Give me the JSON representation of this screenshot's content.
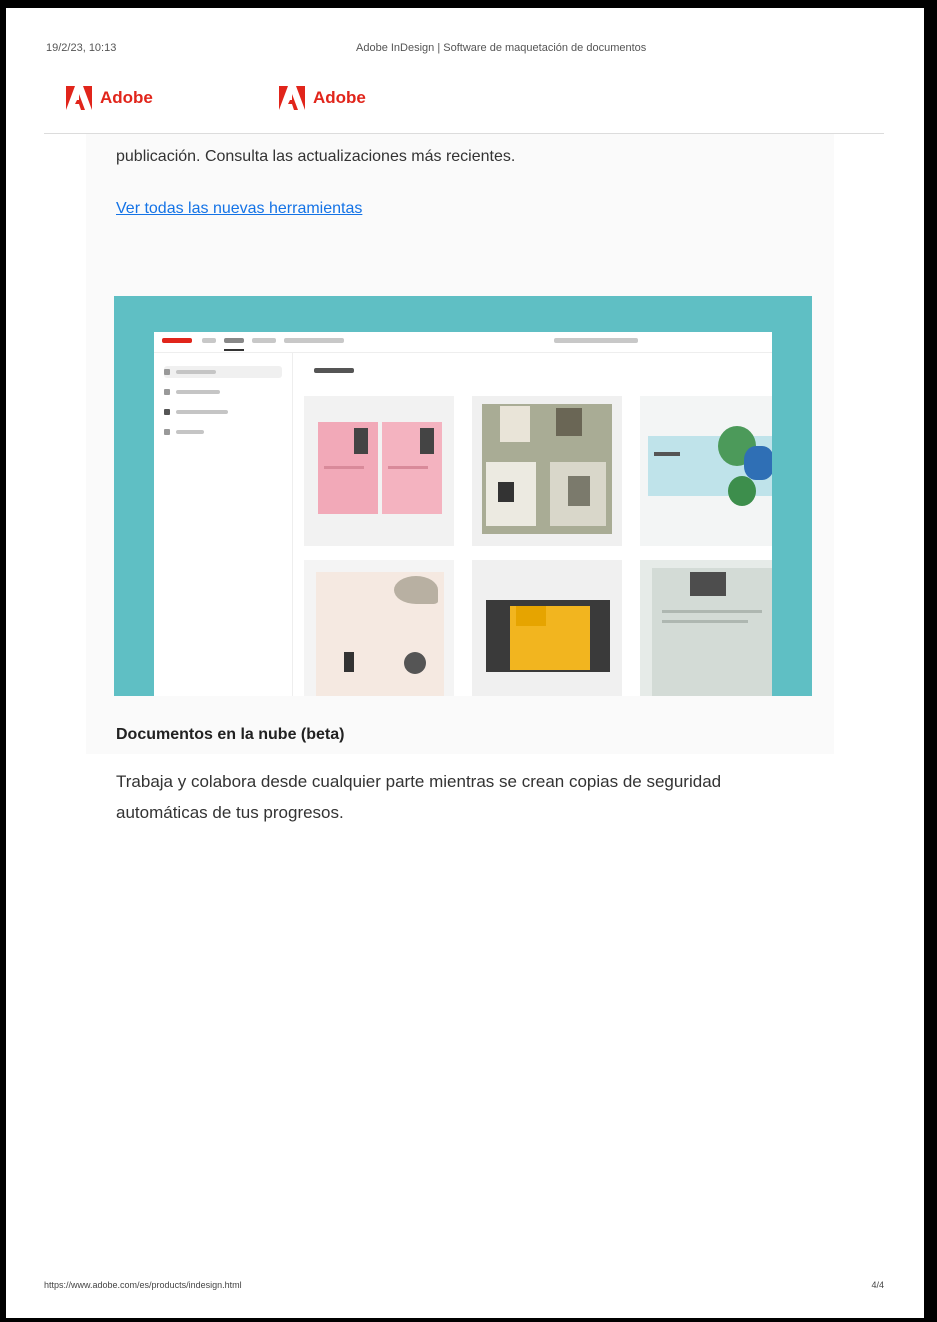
{
  "print": {
    "date": "19/2/23, 10:13",
    "title": "Adobe InDesign | Software de maquetación de documentos",
    "footer_url": "https://www.adobe.com/es/products/indesign.html",
    "page_number": "4/4"
  },
  "brand": {
    "name": "Adobe",
    "color": "#e1251b",
    "icon": "adobe-logo-icon"
  },
  "article": {
    "lead_text": "publicación. Consulta las actualizaciones más recientes.",
    "link_text": "Ver todas las nuevas herramientas",
    "section_title": "Documentos en la nube (beta)",
    "section_body": "Trabaja y colabora desde cualquier parte mientras se crean copias de seguridad automáticas de tus progresos."
  },
  "colors": {
    "hero_background": "#5fbfc4",
    "link": "#1473e6"
  }
}
